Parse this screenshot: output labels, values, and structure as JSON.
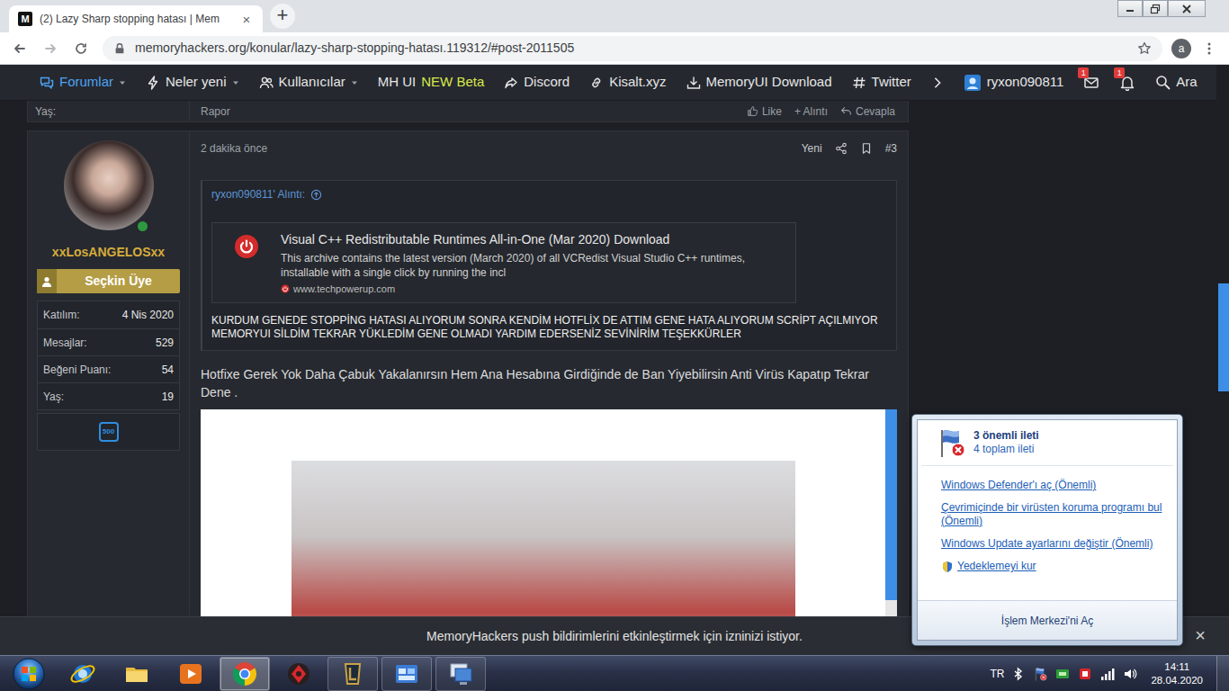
{
  "browser": {
    "tabs": [
      {
        "label": "(2) Lazy Sharp stopping hatası | Mem",
        "icon_text": "M",
        "selected": true
      }
    ],
    "tab_close": "×",
    "new_tab": "+",
    "address": "memoryhackers.org/konular/lazy-sharp-stopping-hatası.119312/#post-2011505",
    "profile": "a"
  },
  "forum_nav": {
    "items": [
      {
        "label": "Forumlar",
        "tag": "",
        "kind": "forums",
        "dropdown": true,
        "selected": true
      },
      {
        "label": "Neler yeni",
        "tag": "",
        "kind": "bolt",
        "dropdown": true,
        "selected": false
      },
      {
        "label": "Kullanıcılar",
        "tag": "",
        "kind": "users",
        "dropdown": true,
        "selected": false
      },
      {
        "label": "MH UI",
        "tag": "NEW Beta",
        "kind": "plain",
        "dropdown": false,
        "selected": false
      },
      {
        "label": "Discord",
        "tag": "",
        "kind": "discord",
        "dropdown": false,
        "selected": false
      },
      {
        "label": "Kisalt.xyz",
        "tag": "",
        "kind": "link",
        "dropdown": false,
        "selected": false
      },
      {
        "label": "MemoryUI Download",
        "tag": "",
        "kind": "download",
        "dropdown": false,
        "selected": false
      },
      {
        "label": "Twitter",
        "tag": "",
        "kind": "hash",
        "dropdown": false,
        "selected": false
      }
    ],
    "user": "ryxon090811",
    "inbox_badge": "1",
    "alerts_badge": "1",
    "search": "Ara"
  },
  "previous_post": {
    "age_label": "Yaş:",
    "report": "Rapor",
    "actions": [
      "Like",
      "+ Alıntı",
      "Cevapla"
    ]
  },
  "post": {
    "time": "2 dakika önce",
    "new": "Yeni",
    "number": "#3",
    "author": {
      "name": "xxLosANGELOSxx",
      "online": true,
      "rank": "Seçkin Üye",
      "stats": [
        {
          "label": "Katılım:",
          "value": "4 Nis 2020"
        },
        {
          "label": "Mesajlar:",
          "value": "529"
        },
        {
          "label": "Beğeni Puanı:",
          "value": "54"
        },
        {
          "label": "Yaş:",
          "value": "19"
        }
      ],
      "badge": "500"
    },
    "quote": {
      "header": "ryxon090811' Alıntı:",
      "embed": {
        "title": "Visual C++ Redistributable Runtimes All-in-One (Mar 2020) Download",
        "description": "This archive contains the latest version (March 2020) of all VCRedist Visual Studio C++ runtimes, installable with a single click by running the incl",
        "site": "www.techpowerup.com"
      },
      "text": "KURDUM GENEDE STOPPİNG HATASI ALIYORUM SONRA KENDİM HOTFLİX DE ATTIM GENE HATA ALIYORUM SCRİPT AÇILMIYOR MEMORYUI SİLDİM TEKRAR YÜKLEDİM GENE OLMADI YARDIM EDERSENİZ SEVİNİRİM TEŞEKKÜRLER"
    },
    "body": "Hotfixe Gerek Yok Daha Çabuk Yakalanırsın Hem Ana Hesabına Girdiğinde de Ban Yiyebilirsin Anti Virüs Kapatıp Tekrar Dene ."
  },
  "push_bar": {
    "text": "MemoryHackers push bildirimlerini etkinleştirmek için izninizi istiyor.",
    "close": "×"
  },
  "action_center": {
    "title": "3 önemli ileti",
    "subtitle": "4 toplam ileti",
    "links": [
      {
        "label": "Windows Defender'ı aç (Önemli)",
        "kind": "text"
      },
      {
        "label": "Çevrimiçinde bir virüsten koruma programı bul (Önemli)",
        "kind": "text"
      },
      {
        "label": "Windows Update ayarlarını değiştir (Önemli)",
        "kind": "text"
      },
      {
        "label": "Yedeklemeyi kur",
        "kind": "shield"
      }
    ],
    "footer": "İşlem Merkezi'ni Aç"
  },
  "taskbar": {
    "apps": [
      {
        "kind": "ie",
        "open": false,
        "selected": false
      },
      {
        "kind": "explorer",
        "open": false,
        "selected": false
      },
      {
        "kind": "media",
        "open": false,
        "selected": false
      },
      {
        "kind": "chrome",
        "open": true,
        "selected": true
      },
      {
        "kind": "antivirus",
        "open": false,
        "selected": false
      },
      {
        "kind": "league",
        "open": true,
        "selected": false
      },
      {
        "kind": "control",
        "open": true,
        "selected": false
      },
      {
        "kind": "remote",
        "open": true,
        "selected": false
      }
    ],
    "language": "TR",
    "time": "14:11",
    "date": "28.04.2020"
  }
}
